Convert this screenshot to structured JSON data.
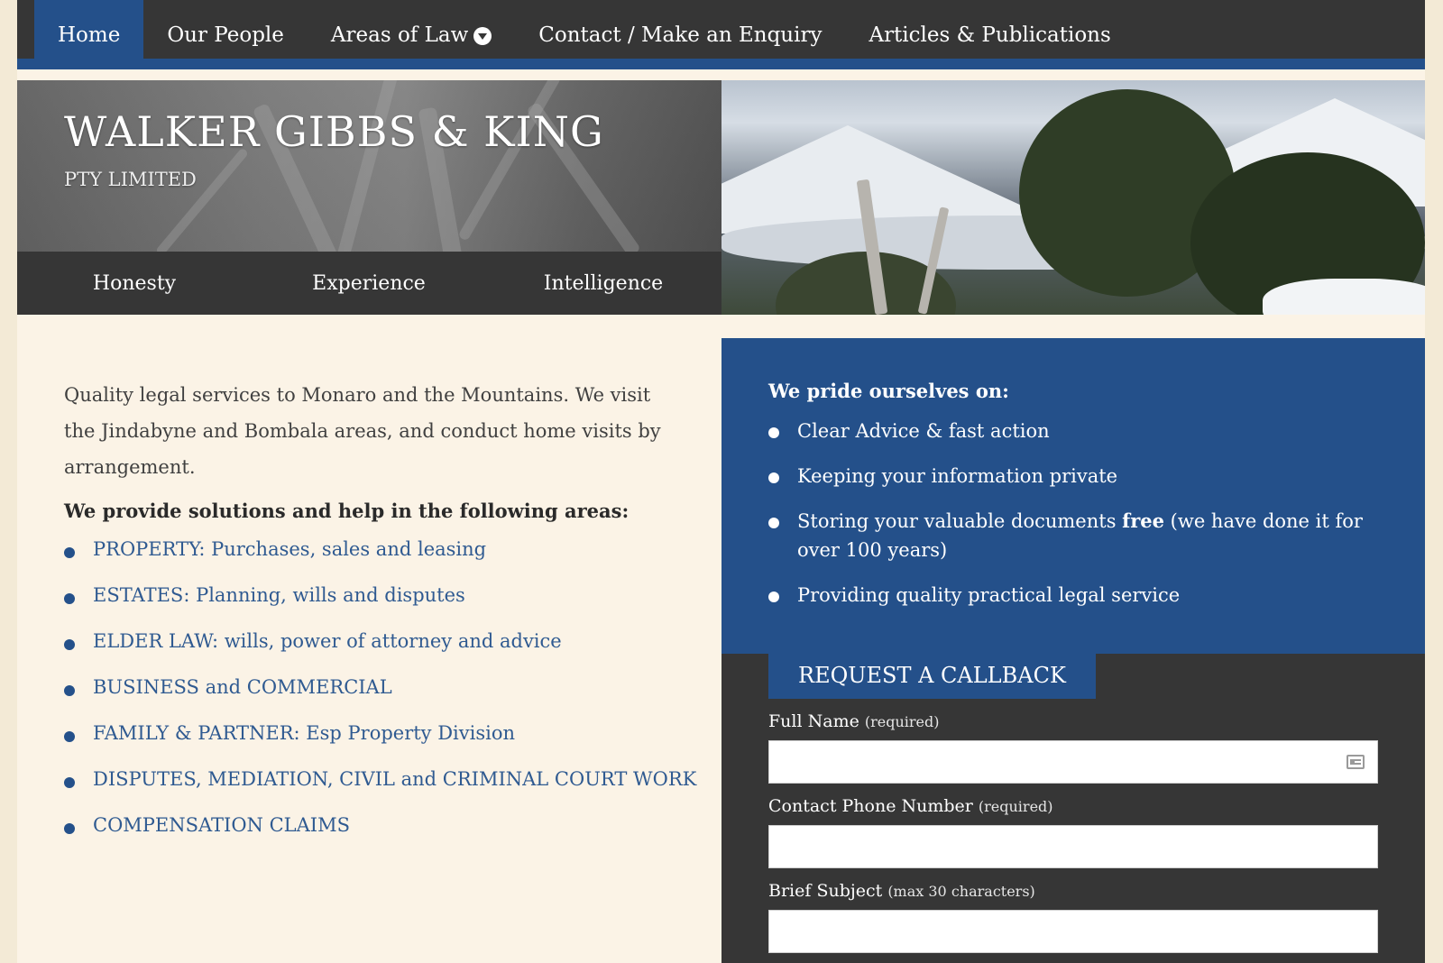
{
  "nav": {
    "items": [
      {
        "label": "Home",
        "active": true
      },
      {
        "label": "Our People"
      },
      {
        "label": "Areas of Law",
        "has_dropdown": true
      },
      {
        "label": "Contact / Make an Enquiry"
      },
      {
        "label": "Articles & Publications"
      }
    ]
  },
  "brand": {
    "title": "WALKER GIBBS & KING",
    "subtitle": "PTY LIMITED"
  },
  "values": [
    "Honesty",
    "Experience",
    "Intelligence"
  ],
  "intro": {
    "text": "Quality legal services to Monaro and the Mountains. We visit the Jindabyne and Bombala areas, and conduct home visits by arrangement.",
    "areas_heading": "We provide solutions and help in the following areas:",
    "areas": [
      "PROPERTY: Purchases, sales and leasing",
      "ESTATES: Planning, wills and disputes",
      "ELDER LAW: wills, power of attorney and advice",
      "BUSINESS and COMMERCIAL",
      "FAMILY & PARTNER: Esp Property Division",
      "DISPUTES, MEDIATION, CIVIL and CRIMINAL COURT WORK",
      "COMPENSATION CLAIMS"
    ]
  },
  "pride": {
    "heading": "We pride ourselves on:",
    "items": {
      "item1": "Clear Advice & fast action",
      "item2": "Keeping your information private",
      "item3_pre": "Storing your valuable documents ",
      "item3_bold": "free",
      "item3_post": " (we have done it for over 100 years)",
      "item4": "Providing quality practical legal service"
    }
  },
  "callback": {
    "tab_label": "REQUEST A CALLBACK",
    "fields": [
      {
        "label": "Full Name",
        "hint": "(required)",
        "value": ""
      },
      {
        "label": "Contact Phone Number",
        "hint": "(required)",
        "value": ""
      },
      {
        "label": "Brief Subject",
        "hint": "(max 30 characters)",
        "value": ""
      }
    ]
  },
  "colors": {
    "accent_blue": "#24508a",
    "nav_dark": "#363636",
    "page_cream": "#fbf3e6",
    "link_blue": "#2f5a91"
  },
  "icons": {
    "dropdown": "circle-chevron-down-icon",
    "autofill": "contact-card-icon"
  }
}
